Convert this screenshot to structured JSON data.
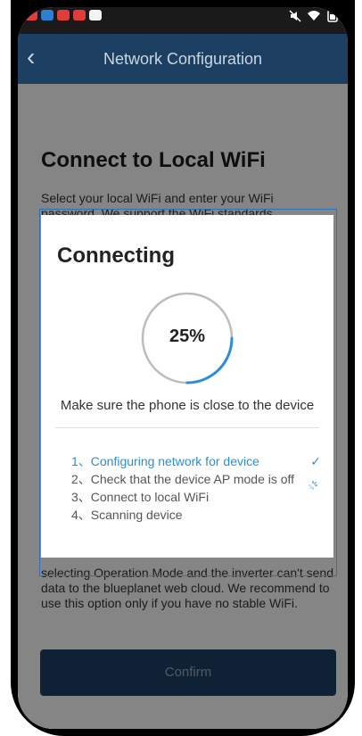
{
  "status_bar": {
    "left_icons": [
      "app-red",
      "app-blue",
      "app-red",
      "app-red",
      "app-white"
    ],
    "right_icons": [
      "mute",
      "wifi",
      "battery"
    ]
  },
  "nav": {
    "back_icon": "‹",
    "title": "Network Configuration"
  },
  "background": {
    "title": "Connect to Local WiFi",
    "desc": "Select your local WiFi and enter your WiFi password. We support the WiFi standards",
    "desc2": "selecting Operation Mode and the inverter can't send data to the blueplanet web cloud. We recommend to use this option only if you have no stable WiFi.",
    "confirm_label": "Confirm"
  },
  "dialog": {
    "title": "Connecting",
    "progress_text": "25%",
    "progress": 0.25,
    "hint": "Make sure the phone is close to the device",
    "steps": [
      {
        "label": "1、Configuring network for device",
        "state": "done"
      },
      {
        "label": "2、Check that the device AP mode is off",
        "state": "in-progress"
      },
      {
        "label": "3、Connect to local WiFi",
        "state": "pending"
      },
      {
        "label": "4、Scanning device",
        "state": "pending"
      }
    ],
    "check_icon": "✓"
  },
  "colors": {
    "navbar": "#1d3f62",
    "accent": "#2a8fd8",
    "ring": "#bdbdbd"
  }
}
